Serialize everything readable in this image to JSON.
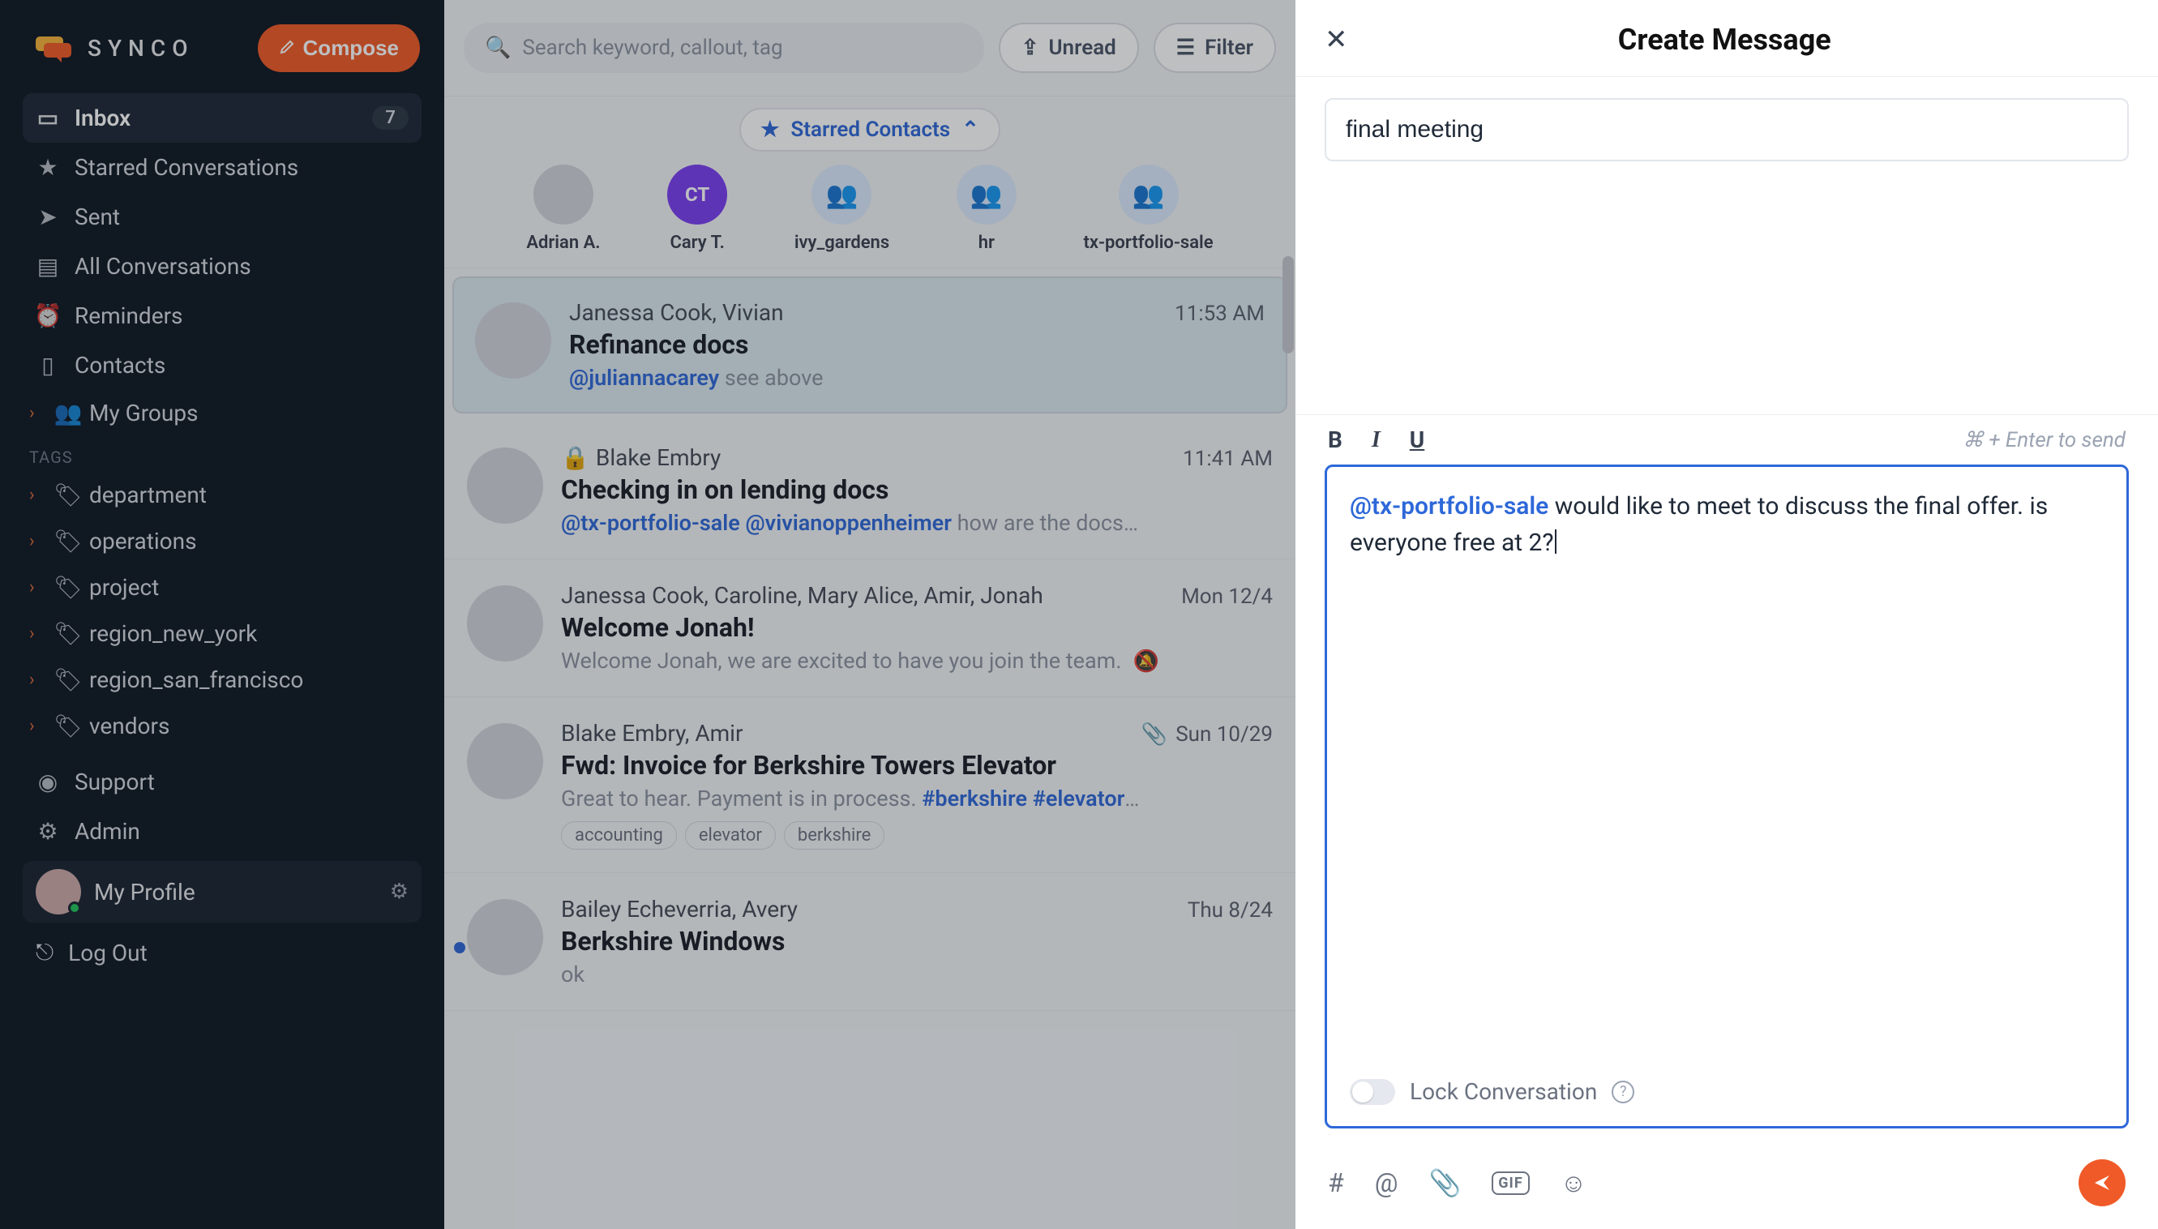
{
  "brand": {
    "name": "SYNCO"
  },
  "compose_button": "Compose",
  "nav": {
    "inbox": {
      "label": "Inbox",
      "badge": "7"
    },
    "starred": "Starred Conversations",
    "sent": "Sent",
    "all": "All Conversations",
    "reminders": "Reminders",
    "contacts": "Contacts",
    "mygroups": "My Groups"
  },
  "tags_label": "TAGS",
  "tags": {
    "department": "department",
    "operations": "operations",
    "project": "project",
    "region_ny": "region_new_york",
    "region_sf": "region_san_francisco",
    "vendors": "vendors"
  },
  "support": "Support",
  "admin": "Admin",
  "profile": "My Profile",
  "logout": "Log Out",
  "search_placeholder": "Search keyword, callout, tag",
  "unread_btn": "Unread",
  "filter_btn": "Filter",
  "starred_contacts_label": "Starred Contacts",
  "contacts_row": {
    "c0": {
      "label": "Adrian A."
    },
    "c1": {
      "label": "Cary T.",
      "initials": "CT"
    },
    "c2": {
      "label": "ivy_gardens"
    },
    "c3": {
      "label": "hr"
    },
    "c4": {
      "label": "tx-portfolio-sale"
    }
  },
  "conversations": {
    "c0": {
      "from": "Janessa Cook, Vivian",
      "time": "11:53 AM",
      "subject": "Refinance docs",
      "mention": "@juliannacarey",
      "rest": " see above"
    },
    "c1": {
      "from": "Blake Embry",
      "time": "11:41 AM",
      "subject": "Checking in on lending docs",
      "mention1": "@tx-portfolio-sale",
      "mention2": "@vivianoppenheimer",
      "rest": " how are the docs…"
    },
    "c2": {
      "from": "Janessa Cook, Caroline, Mary Alice, Amir, Jonah",
      "time": "Mon 12/4",
      "subject": "Welcome Jonah!",
      "preview": "Welcome Jonah, we are excited to have you join the team."
    },
    "c3": {
      "from": "Blake Embry, Amir",
      "time": "Sun 10/29",
      "subject": "Fwd: Invoice for Berkshire Towers Elevator",
      "preview_pre": "Great to hear. Payment is in process. ",
      "hash1": "#berkshire",
      "hash2": "#elevator",
      "ell": "…",
      "tag_a": "accounting",
      "tag_b": "elevator",
      "tag_c": "berkshire"
    },
    "c4": {
      "from": "Bailey Echeverria, Avery",
      "time": "Thu 8/24",
      "subject": "Berkshire Windows",
      "preview": "ok"
    }
  },
  "compose_panel": {
    "title": "Create Message",
    "subject": "final meeting",
    "send_hint": "⌘ + Enter to send",
    "body_mention": "@tx-portfolio-sale",
    "body_rest": " would like to meet to discuss the final offer. is everyone free at 2?",
    "lock_label": "Lock Conversation"
  }
}
